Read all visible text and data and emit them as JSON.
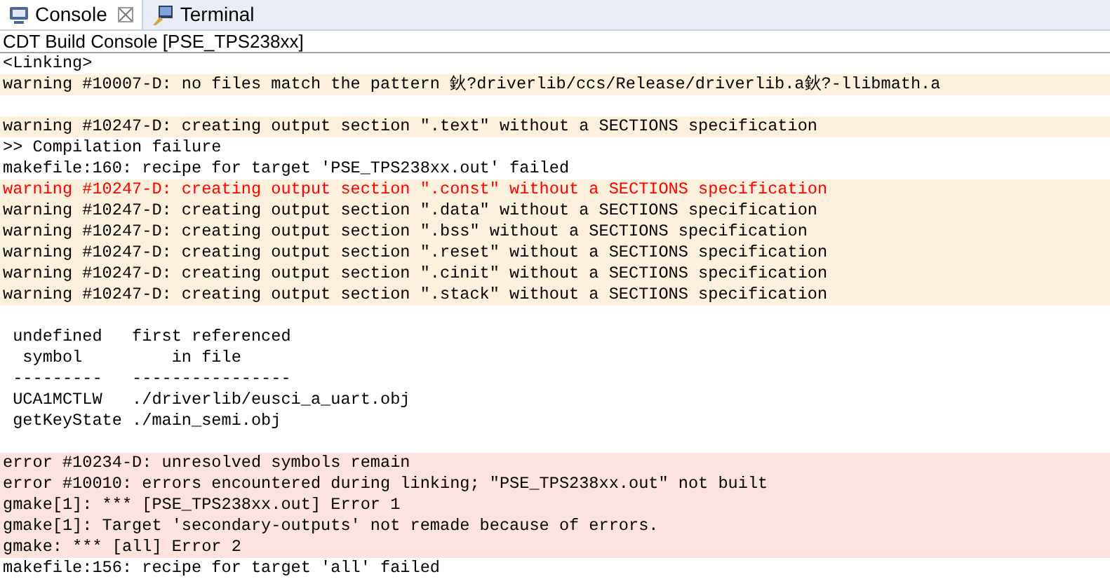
{
  "tabs": [
    {
      "label": "Console",
      "selected": true,
      "closable": true,
      "kind": "monitor"
    },
    {
      "label": "Terminal",
      "selected": false,
      "closable": false,
      "kind": "terminal"
    }
  ],
  "console": {
    "title": "CDT Build Console [PSE_TPS238xx]",
    "lines": [
      {
        "kind": "text",
        "text": "<Linking>"
      },
      {
        "kind": "warning",
        "text": "warning #10007-D: no files match the pattern 鈥?driverlib/ccs/Release/driverlib.a鈥?-llibmath.a"
      },
      {
        "kind": "blank"
      },
      {
        "kind": "warning",
        "text": "warning #10247-D: creating output section \".text\" without a SECTIONS specification"
      },
      {
        "kind": "text",
        "text": ">> Compilation failure"
      },
      {
        "kind": "text",
        "text": "makefile:160: recipe for target 'PSE_TPS238xx.out' failed"
      },
      {
        "kind": "warning-alert",
        "text": "warning #10247-D: creating output section \".const\" without a SECTIONS specification"
      },
      {
        "kind": "warning",
        "text": "warning #10247-D: creating output section \".data\" without a SECTIONS specification"
      },
      {
        "kind": "warning",
        "text": "warning #10247-D: creating output section \".bss\" without a SECTIONS specification"
      },
      {
        "kind": "warning",
        "text": "warning #10247-D: creating output section \".reset\" without a SECTIONS specification"
      },
      {
        "kind": "warning",
        "text": "warning #10247-D: creating output section \".cinit\" without a SECTIONS specification"
      },
      {
        "kind": "warning",
        "text": "warning #10247-D: creating output section \".stack\" without a SECTIONS specification"
      },
      {
        "kind": "blank"
      },
      {
        "kind": "text",
        "text": " undefined   first referenced"
      },
      {
        "kind": "text",
        "text": "  symbol         in file"
      },
      {
        "kind": "text",
        "text": " ---------   ----------------"
      },
      {
        "kind": "text",
        "text": " UCA1MCTLW   ./driverlib/eusci_a_uart.obj"
      },
      {
        "kind": "text",
        "text": " getKeyState ./main_semi.obj"
      },
      {
        "kind": "blank"
      },
      {
        "kind": "error",
        "text": "error #10234-D: unresolved symbols remain"
      },
      {
        "kind": "error",
        "text": "error #10010: errors encountered during linking; \"PSE_TPS238xx.out\" not built"
      },
      {
        "kind": "error",
        "text": "gmake[1]: *** [PSE_TPS238xx.out] Error 1"
      },
      {
        "kind": "error",
        "text": "gmake[1]: Target 'secondary-outputs' not remade because of errors."
      },
      {
        "kind": "error",
        "text": "gmake: *** [all] Error 2"
      },
      {
        "kind": "text",
        "text": "makefile:156: recipe for target 'all' failed"
      }
    ]
  }
}
